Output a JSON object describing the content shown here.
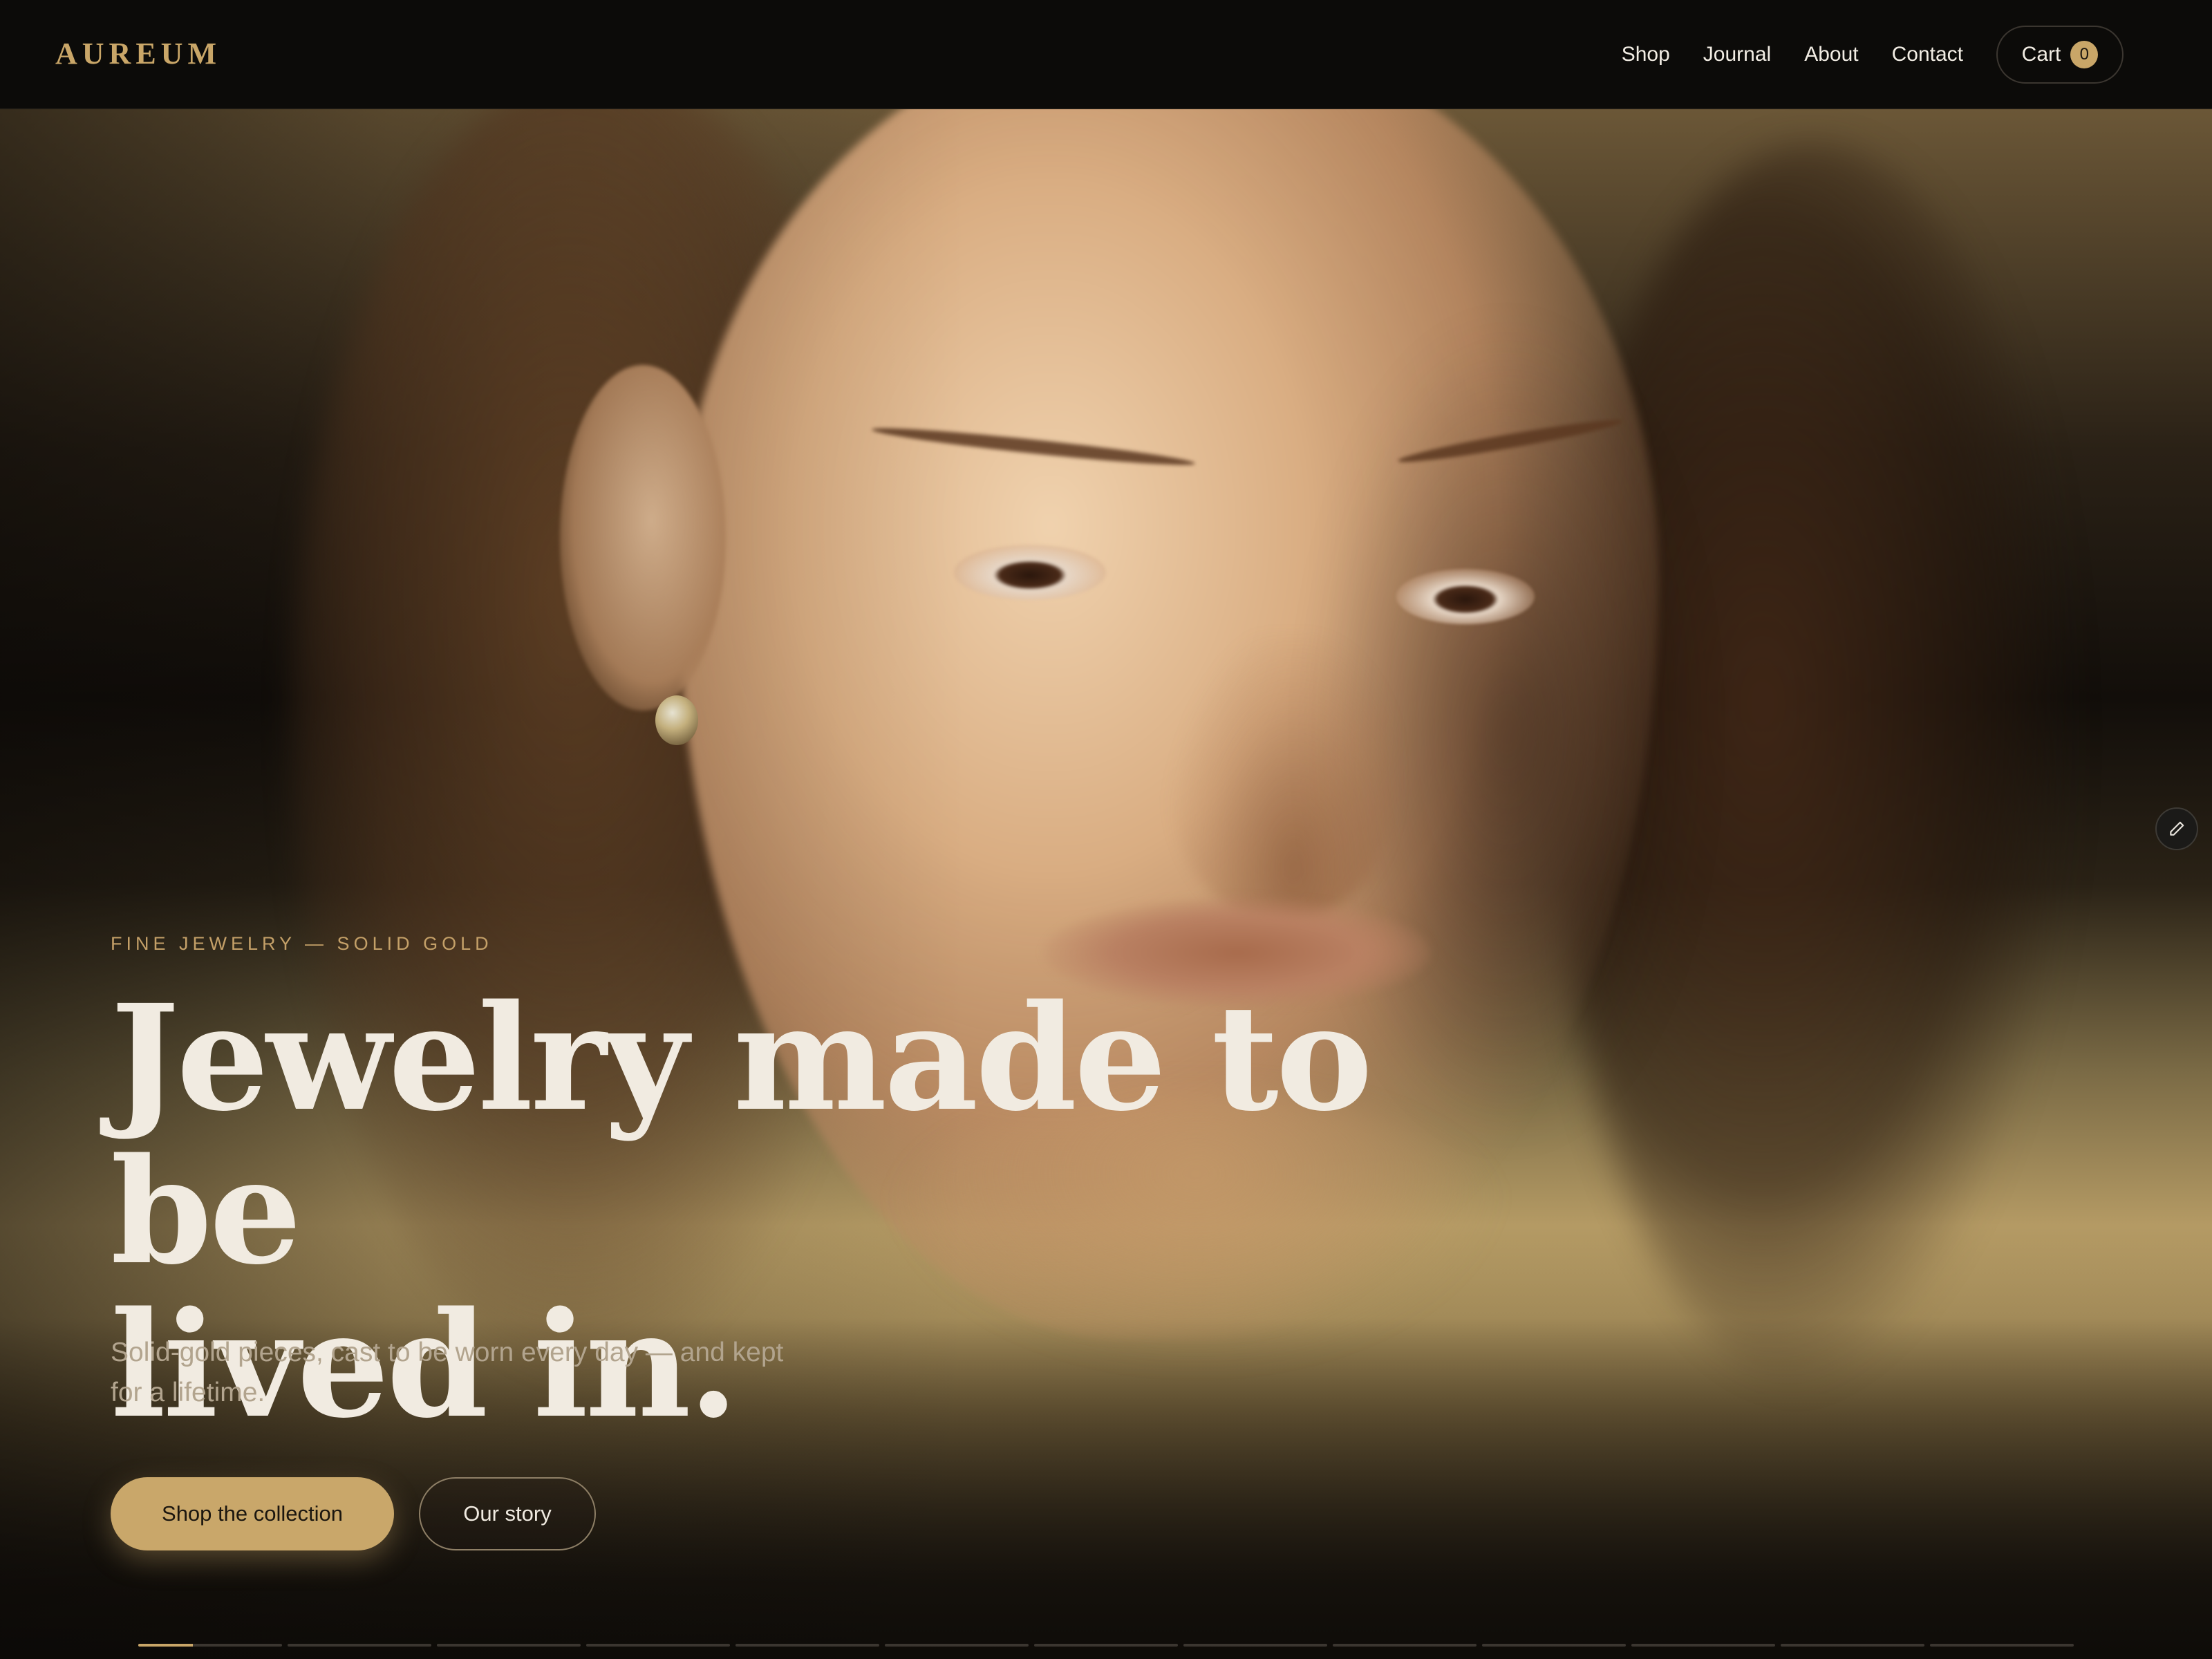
{
  "brand": {
    "name": "AUREUM"
  },
  "nav": {
    "items": [
      {
        "label": "Shop"
      },
      {
        "label": "Journal"
      },
      {
        "label": "About"
      },
      {
        "label": "Contact"
      }
    ],
    "cart": {
      "label": "Cart",
      "count": "0"
    }
  },
  "hero": {
    "eyebrow": "FINE JEWELRY — SOLID GOLD",
    "headline_line1": "Jewelry made to be",
    "headline_line2": "lived in.",
    "subtitle": "Solid-gold pieces, cast to be worn every day — and kept for a lifetime.",
    "primary_cta": "Shop the collection",
    "secondary_cta": "Our story",
    "image_alt_icon": "portrait-photo"
  },
  "edit_fab": {
    "icon": "pencil-icon"
  },
  "slider": {
    "total_slides": 13,
    "active_index": 0,
    "active_progress": 0.38
  },
  "colors": {
    "accent": "#c9a668",
    "background": "#0c0b09",
    "text_light": "#f1ebe1",
    "eyebrow": "#c4a068",
    "subtitle": "#b2a48e"
  }
}
